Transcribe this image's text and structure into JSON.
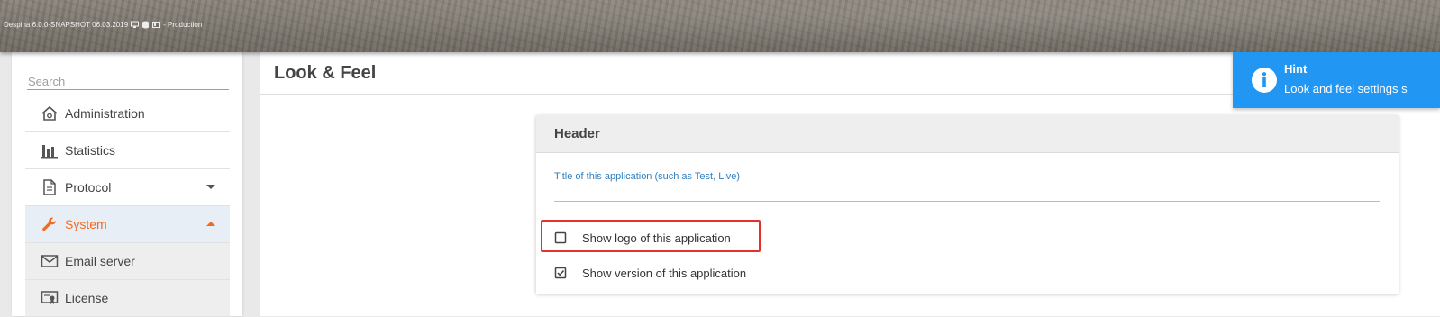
{
  "app": {
    "version": "Despina 6.0.0-SNAPSHOT 06.03.2019",
    "environment": "- Production",
    "icons": [
      "monitor-icon",
      "database-icon",
      "id-card-icon"
    ]
  },
  "sidebar": {
    "search_placeholder": "Search",
    "items": [
      {
        "label": "Administration",
        "icon": "house-settings-icon"
      },
      {
        "label": "Statistics",
        "icon": "bar-chart-icon"
      },
      {
        "label": "Protocol",
        "icon": "document-icon",
        "expand": "collapsed"
      },
      {
        "label": "System",
        "icon": "wrench-icon",
        "expand": "expanded",
        "active": true
      },
      {
        "label": "Email server",
        "icon": "envelope-icon",
        "submenu": true
      },
      {
        "label": "License",
        "icon": "certificate-icon",
        "submenu": true
      }
    ]
  },
  "page": {
    "title": "Look & Feel"
  },
  "card": {
    "header": "Header",
    "title_field_label": "Title of this application (such as Test, Live)",
    "title_field_value": "",
    "checkbox_logo": {
      "label": "Show logo of this application",
      "checked": false
    },
    "checkbox_version": {
      "label": "Show version of this application",
      "checked": true
    }
  },
  "hint": {
    "title": "Hint",
    "text": "Look and feel settings s"
  },
  "colors": {
    "accent": "#f26b1d",
    "hint_bg": "#2196f3",
    "label_blue": "#2f7fbf",
    "highlight": "#e5322d"
  }
}
